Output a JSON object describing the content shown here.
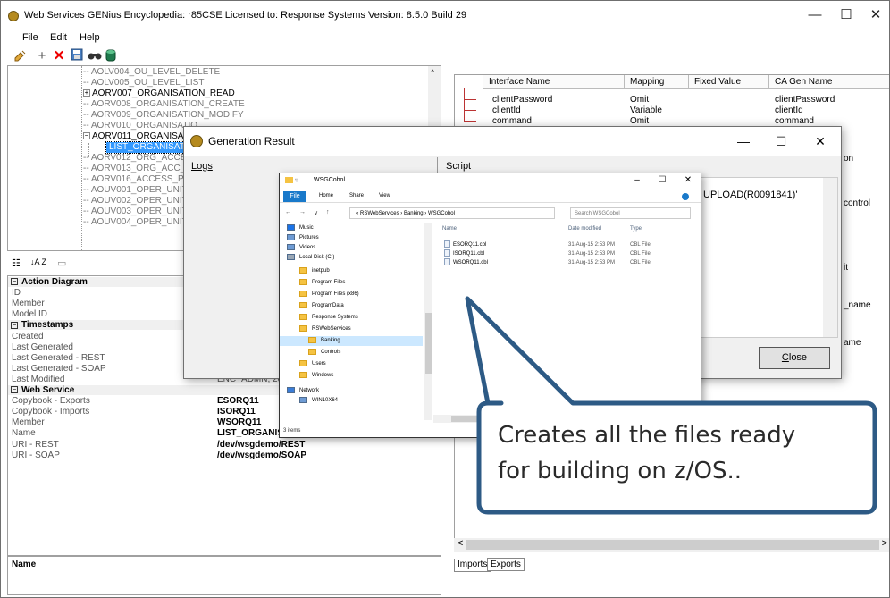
{
  "window": {
    "title": "Web Services GENius  Encyclopedia: r85CSE   Licensed to: Response Systems   Version: 8.5.0 Build 29",
    "minimize": "—",
    "maximize": "☐",
    "close": "✕"
  },
  "menu": {
    "items": [
      "File",
      "Edit",
      "Help"
    ]
  },
  "toolbar": {
    "icons": [
      "open-icon",
      "add-icon",
      "delete-icon",
      "save-icon",
      "find-icon",
      "database-icon"
    ],
    "add": "+",
    "delete": "✕"
  },
  "tree": {
    "nodes": [
      {
        "label": "AOLV004_OU_LEVEL_DELETE",
        "dark": false
      },
      {
        "label": "AOLV005_OU_LEVEL_LIST",
        "dark": false
      },
      {
        "label": "AORV007_ORGANISATION_READ",
        "dark": true,
        "expander": "+"
      },
      {
        "label": "AORV008_ORGANISATION_CREATE",
        "dark": false
      },
      {
        "label": "AORV009_ORGANISATION_MODIFY",
        "dark": false
      },
      {
        "label": "AORV010_ORGANISATIO",
        "dark": false
      },
      {
        "label": "AORV011_ORGANISATIO",
        "dark": true,
        "expander": "−"
      },
      {
        "label": "LIST_ORGANISATION",
        "selected": true
      },
      {
        "label": "AORV012_ORG_ACCESS",
        "dark": false
      },
      {
        "label": "AORV013_ORG_ACC_PF",
        "dark": false
      },
      {
        "label": "AORV016_ACCESS_PRO",
        "dark": false
      },
      {
        "label": "AOUV001_OPER_UNIT_",
        "dark": false
      },
      {
        "label": "AOUV002_OPER_UNIT_",
        "dark": false
      },
      {
        "label": "AOUV003_OPER_UNIT_",
        "dark": false
      },
      {
        "label": "AOUV004_OPER_UNIT_",
        "dark": false
      }
    ],
    "scroll_up": "^"
  },
  "propbar": {
    "categorized": "☷",
    "alpha": "↓A Z",
    "pages": "▭"
  },
  "properties": {
    "rows": [
      {
        "cat": true,
        "key": "Action Diagram",
        "box": "−"
      },
      {
        "key": "ID",
        "value": ""
      },
      {
        "key": "Member",
        "value": ""
      },
      {
        "key": "Model ID",
        "value": ""
      },
      {
        "cat": true,
        "key": "Timestamps",
        "box": "−"
      },
      {
        "key": "Created",
        "value": ""
      },
      {
        "key": "Last Generated",
        "value": ""
      },
      {
        "key": "Last Generated - REST",
        "value": ""
      },
      {
        "key": "Last Generated - SOAP",
        "value": ""
      },
      {
        "key": "Last Modified",
        "value": "ENCYADMN, 201",
        "plain": true
      },
      {
        "cat": true,
        "key": "Web Service",
        "box": "−"
      },
      {
        "key": "Copybook - Exports",
        "value": "ESORQ11"
      },
      {
        "key": "Copybook - Imports",
        "value": "ISORQ11"
      },
      {
        "key": "Member",
        "value": "WSORQ11"
      },
      {
        "key": "Name",
        "value": "LIST_ORGANISATION"
      },
      {
        "key": "URI - REST",
        "value": "/dev/wsgdemo/REST"
      },
      {
        "key": "URI - SOAP",
        "value": "/dev/wsgdemo/SOAP"
      }
    ]
  },
  "name_box": {
    "label": "Name"
  },
  "grid": {
    "headers": [
      "Interface Name",
      "Mapping",
      "Fixed Value",
      "CA Gen Name"
    ],
    "rows": [
      [
        "clientPassword",
        "Omit",
        "",
        "clientPassword"
      ],
      [
        "clientId",
        "Variable",
        "",
        "clientId"
      ],
      [
        "command",
        "Omit",
        "",
        "command"
      ]
    ],
    "partial_right": [
      "on",
      "",
      "control",
      "",
      "",
      "it",
      "",
      "_name",
      "",
      "ame"
    ]
  },
  "hscroll": {
    "left": "<",
    "right": ">"
  },
  "tabs": {
    "imports": "Imports",
    "exports": "Exports"
  },
  "dialog": {
    "title": "Generation Result",
    "minimize": "—",
    "maximize": "☐",
    "close": "✕",
    "logs_header": "Logs",
    "script_header": "Script",
    "script_text": "UPLOAD(R0091841)'",
    "close_button": "Close"
  },
  "explorer": {
    "title": "WSGCobol",
    "ribbon": [
      "File",
      "Home",
      "Share",
      "View"
    ],
    "path": [
      "«",
      "RSWebServices",
      "›",
      "Banking",
      "›",
      "WSGCobol"
    ],
    "search_placeholder": "Search WSGCobol",
    "nav": {
      "back": "←",
      "forward": "→",
      "recent": "∨",
      "up": "↑"
    },
    "sidebar": [
      {
        "label": "Music",
        "indent": 1,
        "icon": "music-icon"
      },
      {
        "label": "Pictures",
        "indent": 1,
        "icon": "pictures-icon"
      },
      {
        "label": "Videos",
        "indent": 1,
        "icon": "videos-icon"
      },
      {
        "label": "Local Disk (C:)",
        "indent": 1,
        "icon": "disk-icon"
      },
      {
        "label": "inetpub",
        "indent": 2
      },
      {
        "label": "Program Files",
        "indent": 2
      },
      {
        "label": "Program Files (x86)",
        "indent": 2
      },
      {
        "label": "ProgramData",
        "indent": 2
      },
      {
        "label": "Response Systems",
        "indent": 2
      },
      {
        "label": "RSWebServices",
        "indent": 2
      },
      {
        "label": "Banking",
        "indent": 3,
        "selected": true
      },
      {
        "label": "Controls",
        "indent": 3
      },
      {
        "label": "Users",
        "indent": 2
      },
      {
        "label": "Windows",
        "indent": 2
      },
      {
        "label": "Network",
        "indent": 1,
        "icon": "network-icon"
      },
      {
        "label": "WIN10X64",
        "indent": 2,
        "icon": "computer-icon"
      }
    ],
    "headers": [
      "Name",
      "Date modified",
      "Type"
    ],
    "files": [
      {
        "name": "ESORQ11.cbl",
        "date": "31-Aug-15 2:53 PM",
        "type": "CBL File"
      },
      {
        "name": "ISORQ11.cbl",
        "date": "31-Aug-15 2:53 PM",
        "type": "CBL File"
      },
      {
        "name": "WSORQ11.cbl",
        "date": "31-Aug-15 2:53 PM",
        "type": "CBL File"
      }
    ],
    "status": "3 items"
  },
  "callout": {
    "line1": "Creates all the files ready",
    "line2": "for building on z/OS..",
    "border_color": "#2d5a85"
  }
}
